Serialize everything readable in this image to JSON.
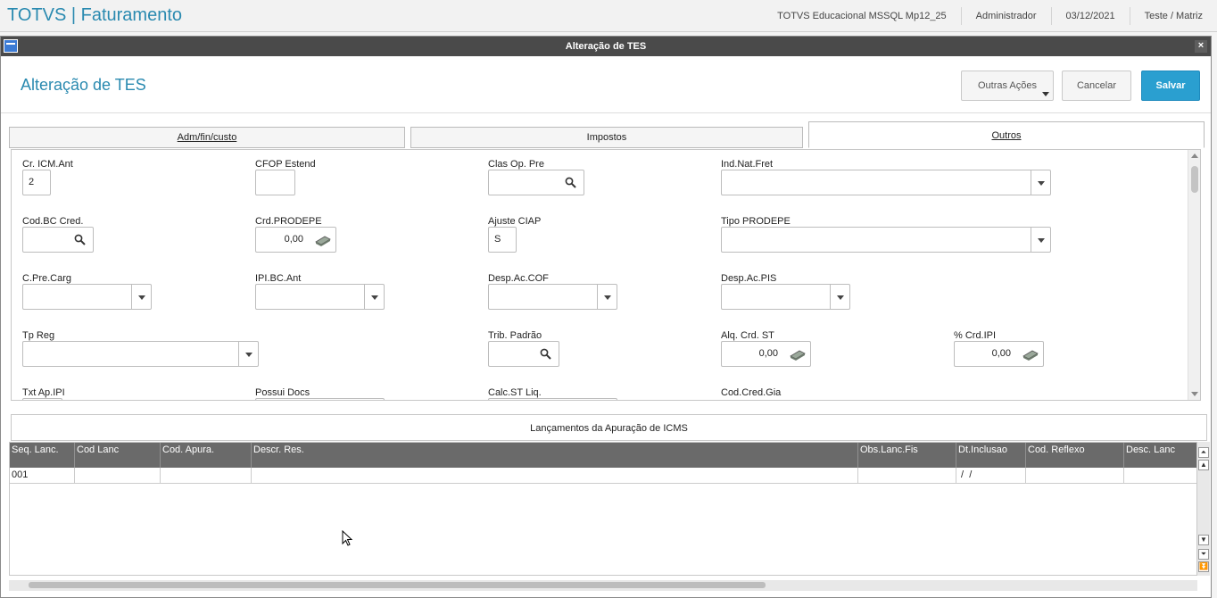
{
  "app": {
    "title": "TOTVS | Faturamento",
    "environment": "TOTVS Educacional MSSQL Mp12_25",
    "user": "Administrador",
    "date": "03/12/2021",
    "company": "Teste / Matriz"
  },
  "dialog": {
    "window_title": "Alteração de TES",
    "page_title": "Alteração de TES",
    "buttons": {
      "more": "Outras Ações",
      "cancel": "Cancelar",
      "save": "Salvar"
    }
  },
  "tabs": [
    {
      "label": "Adm/fin/custo",
      "active": false
    },
    {
      "label": "Impostos",
      "active": false
    },
    {
      "label": "Outros",
      "active": true
    }
  ],
  "form": {
    "cr_icm_ant": {
      "label": "Cr. ICM.Ant",
      "value": "2"
    },
    "cfop_estend": {
      "label": "CFOP Estend",
      "value": ""
    },
    "clas_op_pre": {
      "label": "Clas Op. Pre",
      "value": ""
    },
    "ind_nat_fret": {
      "label": "Ind.Nat.Fret",
      "value": ""
    },
    "cod_bc_cred": {
      "label": "Cod.BC Cred.",
      "value": ""
    },
    "crd_prodepe": {
      "label": "Crd.PRODEPE",
      "value": "0,00"
    },
    "ajuste_ciap": {
      "label": "Ajuste CIAP",
      "value": "S"
    },
    "tipo_prodepe": {
      "label": "Tipo PRODEPE",
      "value": ""
    },
    "c_pre_carg": {
      "label": "C.Pre.Carg",
      "value": ""
    },
    "ipi_bc_ant": {
      "label": "IPI.BC.Ant",
      "value": ""
    },
    "desp_ac_cof": {
      "label": "Desp.Ac.COF",
      "value": ""
    },
    "desp_ac_pis": {
      "label": "Desp.Ac.PIS",
      "value": ""
    },
    "tp_reg": {
      "label": "Tp Reg",
      "value": ""
    },
    "trib_padrao": {
      "label": "Trib. Padrão",
      "value": ""
    },
    "alq_crd_st": {
      "label": "Alq. Crd. ST",
      "value": "0,00"
    },
    "pct_crd_ipi": {
      "label": "% Crd.IPI",
      "value": "0,00"
    },
    "txt_ap_ipi": {
      "label": "Txt Ap.IPI",
      "value": ""
    },
    "possui_docs": {
      "label": "Possui Docs",
      "value": ""
    },
    "calc_st_liq": {
      "label": "Calc.ST Liq.",
      "value": ""
    },
    "cod_cred_gia": {
      "label": "Cod.Cred.Gia",
      "value": ""
    }
  },
  "grid": {
    "title": "Lançamentos da Apuração de ICMS",
    "columns": [
      "Seq. Lanc.",
      "Cod Lanc",
      "Cod. Apura.",
      "Descr. Res.",
      "Obs.Lanc.Fis",
      "Dt.Inclusao",
      "Cod. Reflexo",
      "Desc. Lanc"
    ],
    "rows": [
      [
        "001",
        "",
        "",
        "",
        "",
        " /  /",
        "",
        ""
      ]
    ]
  },
  "icons": {
    "window": "window-icon",
    "close": "close-icon",
    "search": "magnifier-icon",
    "calculator": "calculator-icon",
    "dropdown": "chevron-down-icon"
  }
}
